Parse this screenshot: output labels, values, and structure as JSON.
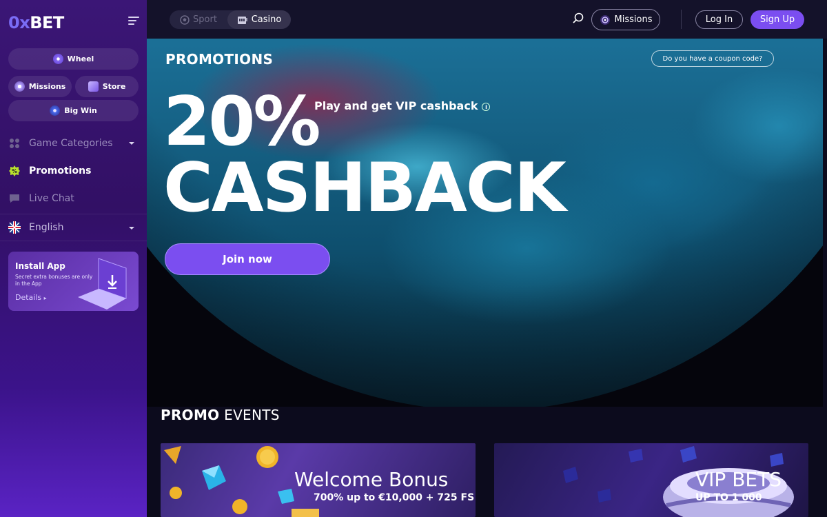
{
  "brand": {
    "logo_prefix": "0x",
    "logo_suffix": "BET"
  },
  "sidebar": {
    "pills": {
      "wheel": "Wheel",
      "missions": "Missions",
      "store": "Store",
      "big_win": "Big Win"
    },
    "nav": {
      "game_categories": "Game Categories",
      "promotions": "Promotions",
      "live_chat": "Live Chat",
      "language": "English"
    },
    "install": {
      "title": "Install App",
      "subtitle": "Secret extra bonuses are only in the App",
      "details": "Details"
    }
  },
  "topbar": {
    "tabs": {
      "sport": "Sport",
      "casino": "Casino"
    },
    "missions": "Missions",
    "login": "Log In",
    "signup": "Sign Up"
  },
  "hero": {
    "section_title": "PROMOTIONS",
    "coupon": "Do you have a coupon code?",
    "percent": "20%",
    "tagline": "Play and get VIP cashback",
    "headline": "CASHBACK",
    "cta": "Join now"
  },
  "events": {
    "title_bold": "PROMO",
    "title_rest": " EVENTS",
    "cards": [
      {
        "title": "Welcome Bonus",
        "subtitle": "700% up to €10,000 + 725 FS"
      },
      {
        "title": "VIP BETS",
        "subtitle": "UP TO 1 000"
      }
    ]
  },
  "colors": {
    "accent": "#7b4ef0",
    "sidebar": "#321065",
    "topbar": "#14122a"
  }
}
